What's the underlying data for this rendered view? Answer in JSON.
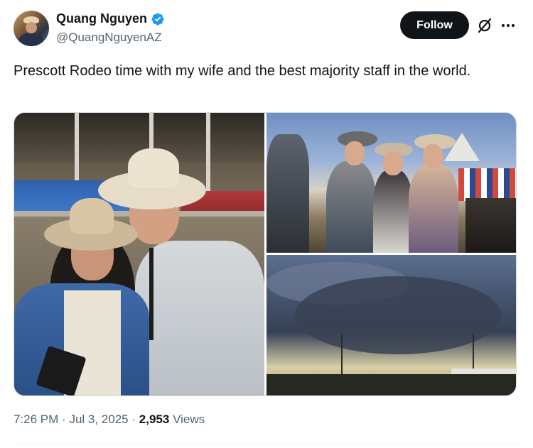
{
  "author": {
    "display_name": "Quang Nguyen",
    "handle": "@QuangNguyenAZ",
    "verified": true
  },
  "actions": {
    "follow_label": "Follow"
  },
  "post": {
    "text": "Prescott Rodeo time with my wife and the best majority staff in the world.",
    "photo_count": 3
  },
  "footer": {
    "time": "7:26 PM",
    "separator": "·",
    "date": "Jul 3, 2025",
    "views_count": "2,953",
    "views_label": "Views"
  },
  "icons": {
    "verified": "verified-badge-icon",
    "grok": "grok-icon",
    "more": "more-icon"
  },
  "colors": {
    "verified_blue": "#1d9bf0",
    "follow_bg": "#0f1419",
    "muted_text": "#536471"
  }
}
